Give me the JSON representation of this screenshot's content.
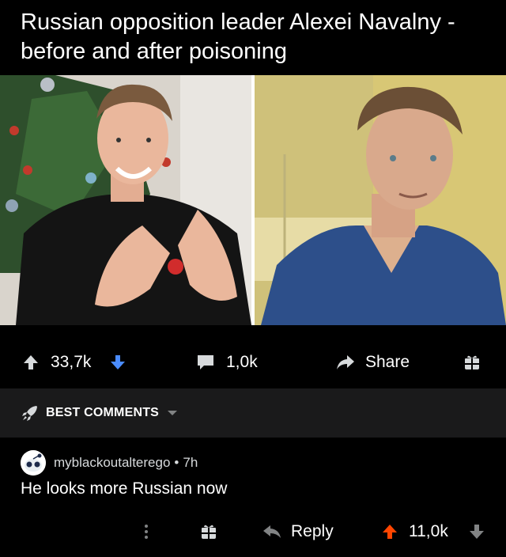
{
  "post": {
    "title": "Russian opposition leader Alexei Navalny - before and after poisoning",
    "image_alt": "before-and-after-photo"
  },
  "actions": {
    "score": "33,7k",
    "comments": "1,0k",
    "share": "Share"
  },
  "sort": {
    "label": "BEST COMMENTS"
  },
  "comment": {
    "username": "myblackoutalterego",
    "separator": "•",
    "age": "7h",
    "body": "He looks more Russian now",
    "reply": "Reply",
    "score": "11,0k"
  },
  "colors": {
    "background": "#000000",
    "panel": "#1a1a1b",
    "upvote_active": "#ff4500",
    "downvote": "#4a8cff",
    "icon_grey": "#d7dadc"
  }
}
